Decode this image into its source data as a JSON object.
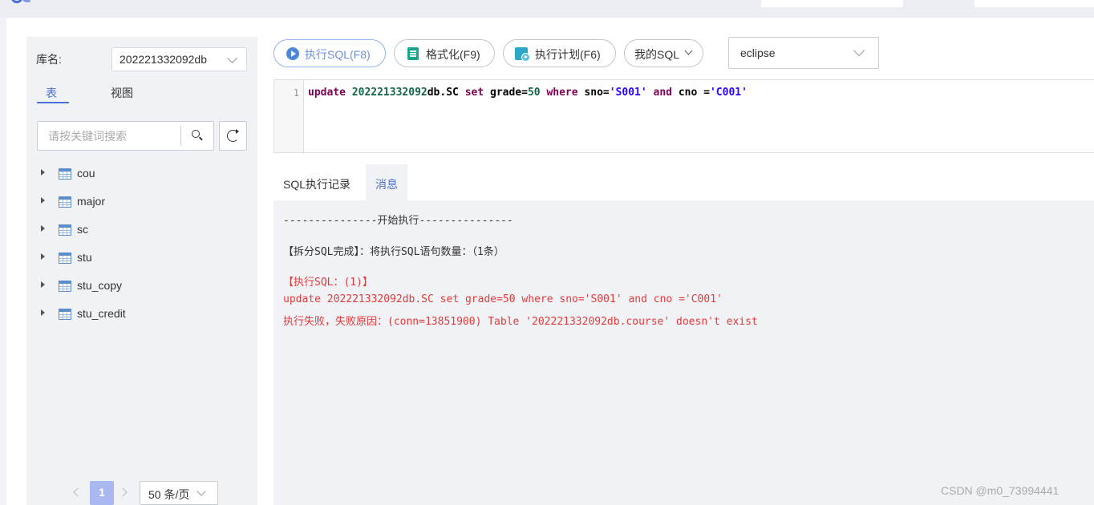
{
  "sidebar": {
    "db_label": "库名:",
    "db_value": "202221332092db",
    "tabs": [
      {
        "label": "表",
        "active": true
      },
      {
        "label": "视图",
        "active": false
      }
    ],
    "search_placeholder": "请按关键词搜索",
    "tables": [
      "cou",
      "major",
      "sc",
      "stu",
      "stu_copy",
      "stu_credit"
    ],
    "pagination": {
      "current_page": "1",
      "page_size": "50 条/页"
    }
  },
  "toolbar": {
    "run_label": "执行SQL(F8)",
    "format_label": "格式化(F9)",
    "plan_label": "执行计划(F6)",
    "mysql_label": "我的SQL",
    "theme_value": "eclipse"
  },
  "editor": {
    "line_number": "1",
    "tokens": {
      "t1": "update",
      "t2": " ",
      "t3": "202221332092",
      "t4": "db.SC ",
      "t5": "set",
      "t6": " grade=",
      "t7": "50",
      "t8": " ",
      "t9": "where",
      "t10": " sno=",
      "t11": "'S001'",
      "t12": " ",
      "t13": "and",
      "t14": " cno =",
      "t15": "'C001'"
    }
  },
  "results": {
    "tabs": [
      {
        "label": "SQL执行记录",
        "active": false
      },
      {
        "label": "消息",
        "active": true
      }
    ],
    "messages": [
      {
        "text": "---------------开始执行---------------",
        "type": "normal"
      },
      {
        "text": "【拆分SQL完成】：将执行SQL语句数量：（1条）",
        "type": "normal"
      },
      {
        "text": "【执行SQL：(1)】",
        "type": "error"
      },
      {
        "text": "update 202221332092db.SC set grade=50 where sno='S001' and cno ='C001'",
        "type": "error"
      },
      {
        "text": "执行失败，失败原因：(conn=13851900) Table '202221332092db.course' doesn't exist",
        "type": "error"
      }
    ]
  },
  "watermark": "CSDN @m0_73994441",
  "colors": {
    "accent": "#4a6fd6",
    "error": "#e33b3b",
    "keyword": "#7f0055",
    "number": "#116644",
    "string": "#2a00ff"
  }
}
